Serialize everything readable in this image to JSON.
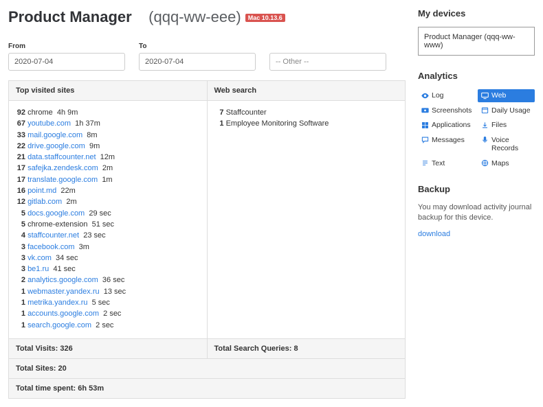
{
  "header": {
    "title": "Product Manager",
    "suffix": "(qqq-ww-eee)",
    "os_badge": "Mac 10.13.6"
  },
  "filters": {
    "from_label": "From",
    "from": "2020-07-04",
    "to_label": "To",
    "to": "2020-07-04",
    "other": "-- Other --"
  },
  "sites_header": "Top visited sites",
  "search_header": "Web search",
  "sites": [
    {
      "count": "92",
      "label": "chrome",
      "link": false,
      "duration": "4h 9m"
    },
    {
      "count": "67",
      "label": "youtube.com",
      "link": true,
      "duration": "1h 37m"
    },
    {
      "count": "33",
      "label": "mail.google.com",
      "link": true,
      "duration": "8m"
    },
    {
      "count": "22",
      "label": "drive.google.com",
      "link": true,
      "duration": "9m"
    },
    {
      "count": "21",
      "label": "data.staffcounter.net",
      "link": true,
      "duration": "12m"
    },
    {
      "count": "17",
      "label": "safejka.zendesk.com",
      "link": true,
      "duration": "2m"
    },
    {
      "count": "17",
      "label": "translate.google.com",
      "link": true,
      "duration": "1m"
    },
    {
      "count": "16",
      "label": "point.md",
      "link": true,
      "duration": "22m"
    },
    {
      "count": "12",
      "label": "gitlab.com",
      "link": true,
      "duration": "2m"
    },
    {
      "count": "5",
      "label": "docs.google.com",
      "link": true,
      "duration": "29 sec"
    },
    {
      "count": "5",
      "label": "chrome-extension",
      "link": false,
      "duration": "51 sec"
    },
    {
      "count": "4",
      "label": "staffcounter.net",
      "link": true,
      "duration": "23 sec"
    },
    {
      "count": "3",
      "label": "facebook.com",
      "link": true,
      "duration": "3m"
    },
    {
      "count": "3",
      "label": "vk.com",
      "link": true,
      "duration": "34 sec"
    },
    {
      "count": "3",
      "label": "be1.ru",
      "link": true,
      "duration": "41 sec"
    },
    {
      "count": "2",
      "label": "analytics.google.com",
      "link": true,
      "duration": "36 sec"
    },
    {
      "count": "1",
      "label": "webmaster.yandex.ru",
      "link": true,
      "duration": "13 sec"
    },
    {
      "count": "1",
      "label": "metrika.yandex.ru",
      "link": true,
      "duration": "5 sec"
    },
    {
      "count": "1",
      "label": "accounts.google.com",
      "link": true,
      "duration": "2 sec"
    },
    {
      "count": "1",
      "label": "search.google.com",
      "link": true,
      "duration": "2 sec"
    }
  ],
  "searches": [
    {
      "count": "7",
      "label": "Staffcounter"
    },
    {
      "count": "1",
      "label": "Employee Monitoring Software"
    }
  ],
  "totals": {
    "visits": "Total Visits: 326",
    "queries": "Total Search Queries: 8",
    "sites": "Total Sites: 20",
    "time": "Total time spent: 6h 53m"
  },
  "side": {
    "devices_header": "My devices",
    "device": "Product Manager (qqq-ww-www)",
    "analytics_header": "Analytics",
    "nav": [
      {
        "icon": "eye",
        "label": "Log",
        "active": false
      },
      {
        "icon": "monitor",
        "label": "Web",
        "active": true
      },
      {
        "icon": "camera",
        "label": "Screenshots",
        "active": false
      },
      {
        "icon": "calendar",
        "label": "Daily Usage",
        "active": false
      },
      {
        "icon": "app",
        "label": "Applications",
        "active": false
      },
      {
        "icon": "download",
        "label": "Files",
        "active": false
      },
      {
        "icon": "message",
        "label": "Messages",
        "active": false
      },
      {
        "icon": "mic",
        "label": "Voice Records",
        "active": false
      },
      {
        "icon": "text",
        "label": "Text",
        "active": false
      },
      {
        "icon": "globe",
        "label": "Maps",
        "active": false
      }
    ],
    "backup_header": "Backup",
    "backup_text": "You may download activity journal backup for this device.",
    "backup_link": "download"
  }
}
